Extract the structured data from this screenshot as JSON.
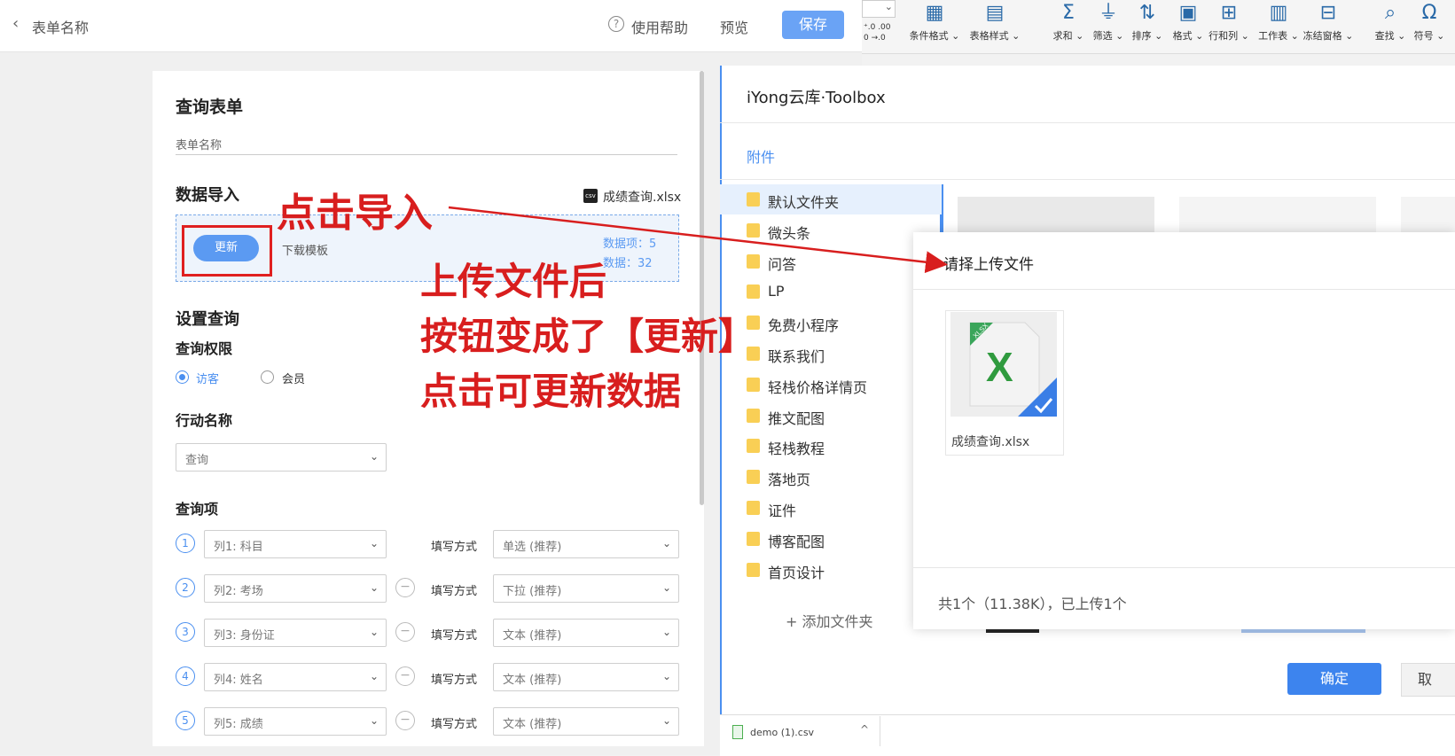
{
  "topbar": {
    "back_glyph": "‹",
    "title": "表单名称",
    "help_icon": "?",
    "help": "使用帮助",
    "preview": "预览",
    "save": "保存"
  },
  "form": {
    "heading": "查询表单",
    "form_name_placeholder": "表单名称",
    "import": {
      "heading": "数据导入",
      "file_badge": "csv",
      "file_name": "成绩查询.xlsx",
      "update_button": "更新",
      "download_template": "下载模板",
      "data_items": "数据项：5",
      "data_rows": "数据：32"
    },
    "query_settings": "设置查询",
    "permission": {
      "label": "查询权限",
      "visitor": "访客",
      "member": "会员",
      "selected": "访客"
    },
    "action": {
      "label": "行动名称",
      "value": "查询"
    },
    "query_items_label": "查询项",
    "fill_label": "填写方式",
    "rows": [
      {
        "num": "1",
        "column": "列1: 科目",
        "mode": "单选 (推荐)"
      },
      {
        "num": "2",
        "column": "列2: 考场",
        "mode": "下拉 (推荐)"
      },
      {
        "num": "3",
        "column": "列3: 身份证",
        "mode": "文本 (推荐)"
      },
      {
        "num": "4",
        "column": "列4: 姓名",
        "mode": "文本 (推荐)"
      },
      {
        "num": "5",
        "column": "列5: 成绩",
        "mode": "文本 (推荐)"
      }
    ]
  },
  "ribbon": {
    "partial_top": "⌄",
    "decimal_a": "⁺.0 .00",
    "decimal_b": "0 →.0",
    "items": [
      {
        "label": "条件格式",
        "icon": "conditional-format-icon"
      },
      {
        "label": "表格样式",
        "icon": "table-style-icon"
      },
      {
        "label": "求和",
        "icon": "sum-icon"
      },
      {
        "label": "筛选",
        "icon": "filter-icon"
      },
      {
        "label": "排序",
        "icon": "sort-icon"
      },
      {
        "label": "格式",
        "icon": "format-icon"
      },
      {
        "label": "行和列",
        "icon": "row-column-icon"
      },
      {
        "label": "工作表",
        "icon": "worksheet-icon"
      },
      {
        "label": "冻结窗格",
        "icon": "freeze-icon"
      },
      {
        "label": "查找",
        "icon": "find-icon"
      },
      {
        "label": "符号",
        "icon": "symbol-icon"
      }
    ]
  },
  "toolbox": {
    "title": "iYong云库·Toolbox",
    "attach_tab": "附件",
    "folders": [
      "默认文件夹",
      "微头条",
      "问答",
      "LP",
      "免费小程序",
      "联系我们",
      "轻栈价格详情页",
      "推文配图",
      "轻栈教程",
      "落地页",
      "证件",
      "博客配图",
      "首页设计"
    ],
    "selected_folder": "默认文件夹",
    "add_folder": "+ 添加文件夹",
    "confirm": "确定",
    "cancel": "取"
  },
  "dialog": {
    "title": "请择上传文件",
    "file_name": "成绩查询.xlsx",
    "file_tag": "XLSX",
    "status": "共1个（11.38K），已上传1个"
  },
  "download_bar": {
    "file": "demo (1).csv",
    "chevron": "^"
  },
  "annotations": {
    "click_import": "点击导入",
    "line1": "上传文件后",
    "line2": "按钮变成了【更新】",
    "line3": "点击可更新数据",
    "color": "#d81e1e"
  },
  "colors": {
    "accent": "#4a8ff0",
    "save_button": "#6aa3f5",
    "annotation": "#d81e1e",
    "folder": "#f9cf55"
  }
}
